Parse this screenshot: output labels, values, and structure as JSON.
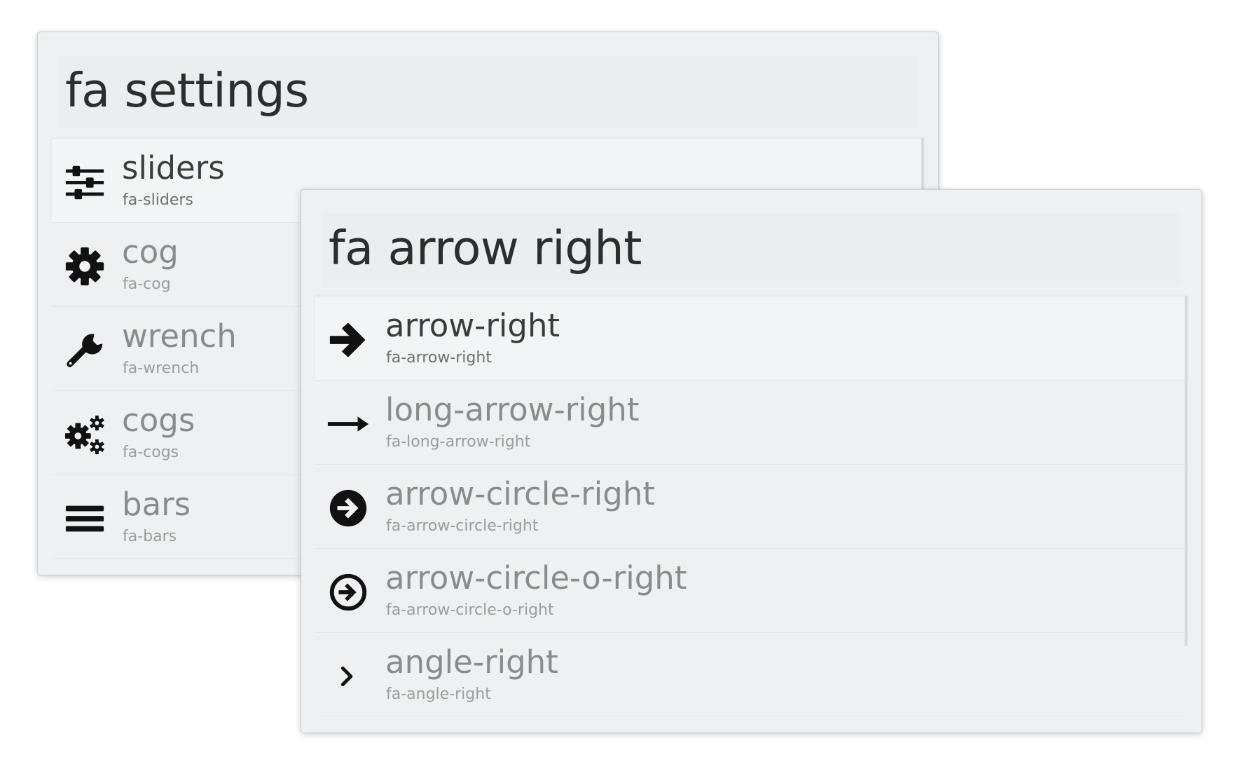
{
  "windows": [
    {
      "query": "fa settings",
      "results": [
        {
          "title": "sliders",
          "subtitle": "fa-sliders",
          "icon": "sliders-icon",
          "selected": true
        },
        {
          "title": "cog",
          "subtitle": "fa-cog",
          "icon": "cog-icon",
          "selected": false
        },
        {
          "title": "wrench",
          "subtitle": "fa-wrench",
          "icon": "wrench-icon",
          "selected": false
        },
        {
          "title": "cogs",
          "subtitle": "fa-cogs",
          "icon": "cogs-icon",
          "selected": false
        },
        {
          "title": "bars",
          "subtitle": "fa-bars",
          "icon": "bars-icon",
          "selected": false
        }
      ]
    },
    {
      "query": "fa arrow right",
      "results": [
        {
          "title": "arrow-right",
          "subtitle": "fa-arrow-right",
          "icon": "arrow-right-icon",
          "selected": true
        },
        {
          "title": "long-arrow-right",
          "subtitle": "fa-long-arrow-right",
          "icon": "long-arrow-right-icon",
          "selected": false
        },
        {
          "title": "arrow-circle-right",
          "subtitle": "fa-arrow-circle-right",
          "icon": "arrow-circle-right-icon",
          "selected": false
        },
        {
          "title": "arrow-circle-o-right",
          "subtitle": "fa-arrow-circle-o-right",
          "icon": "arrow-circle-o-right-icon",
          "selected": false
        },
        {
          "title": "angle-right",
          "subtitle": "fa-angle-right",
          "icon": "angle-right-icon",
          "selected": false
        }
      ]
    }
  ]
}
